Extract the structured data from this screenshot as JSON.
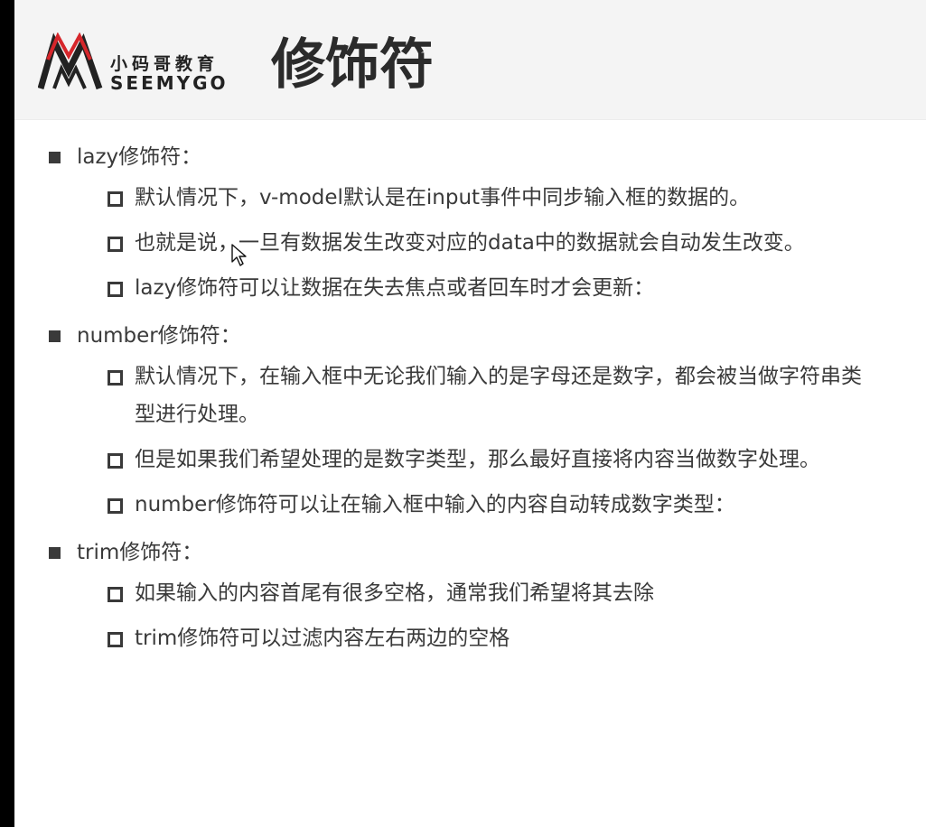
{
  "header": {
    "logo_cn": "小码哥教育",
    "logo_en": "SEEMYGO",
    "title": "修饰符"
  },
  "sections": [
    {
      "heading": "lazy修饰符：",
      "items": [
        "默认情况下，v-model默认是在input事件中同步输入框的数据的。",
        "也就是说，一旦有数据发生改变对应的data中的数据就会自动发生改变。",
        "lazy修饰符可以让数据在失去焦点或者回车时才会更新："
      ]
    },
    {
      "heading": "number修饰符：",
      "items": [
        "默认情况下，在输入框中无论我们输入的是字母还是数字，都会被当做字符串类型进行处理。",
        "但是如果我们希望处理的是数字类型，那么最好直接将内容当做数字处理。",
        "number修饰符可以让在输入框中输入的内容自动转成数字类型："
      ]
    },
    {
      "heading": "trim修饰符：",
      "items": [
        "如果输入的内容首尾有很多空格，通常我们希望将其去除",
        "trim修饰符可以过滤内容左右两边的空格"
      ]
    }
  ],
  "colors": {
    "logo_red": "#d6262b",
    "logo_dark": "#222222",
    "text": "#3a3a3a"
  }
}
